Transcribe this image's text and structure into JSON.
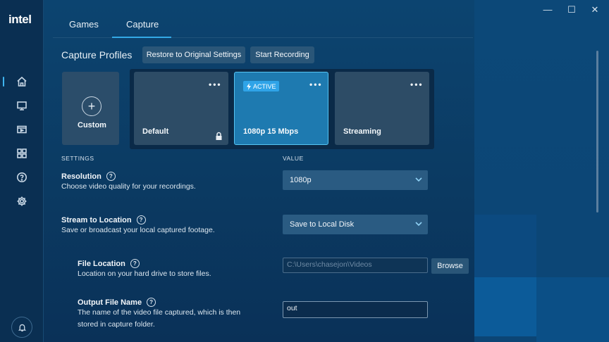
{
  "app": {
    "logo": "intel"
  },
  "window_controls": {
    "minimize": "—",
    "maximize": "☐",
    "close": "✕"
  },
  "sidebar": {
    "items": [
      {
        "icon": "home-icon"
      },
      {
        "icon": "monitor-icon"
      },
      {
        "icon": "video-icon"
      },
      {
        "icon": "apps-grid-icon"
      },
      {
        "icon": "help-icon"
      },
      {
        "icon": "gear-icon"
      }
    ],
    "bottom_icon": "bell-icon"
  },
  "tabs": [
    {
      "label": "Games"
    },
    {
      "label": "Capture"
    }
  ],
  "profiles": {
    "title": "Capture Profiles",
    "restore_label": "Restore to Original Settings",
    "record_label": "Start Recording",
    "custom_label": "Custom",
    "cards": [
      {
        "label": "Default",
        "menu": "•••"
      },
      {
        "label": "1080p 15 Mbps",
        "menu": "•••",
        "badge": "ACTIVE"
      },
      {
        "label": "Streaming",
        "menu": "•••"
      }
    ]
  },
  "settings": {
    "header_settings": "SETTINGS",
    "header_value": "VALUE",
    "resolution": {
      "title": "Resolution",
      "desc": "Choose video quality for your recordings.",
      "value": "1080p"
    },
    "stream_location": {
      "title": "Stream to Location",
      "desc": "Save or broadcast your local captured footage.",
      "value": "Save to Local Disk"
    },
    "file_location": {
      "title": "File Location",
      "desc": "Location on your hard drive to store files.",
      "value": "C:\\Users\\chasejon\\Videos",
      "browse_label": "Browse"
    },
    "output_name": {
      "title": "Output File Name",
      "desc_line1": "The name of the video file captured, which is then",
      "desc_line2": "stored in capture folder.",
      "value": "out"
    }
  },
  "colors": {
    "accent": "#34a9e6",
    "active_card": "#1e7ab0",
    "background": "#0b3a62"
  }
}
